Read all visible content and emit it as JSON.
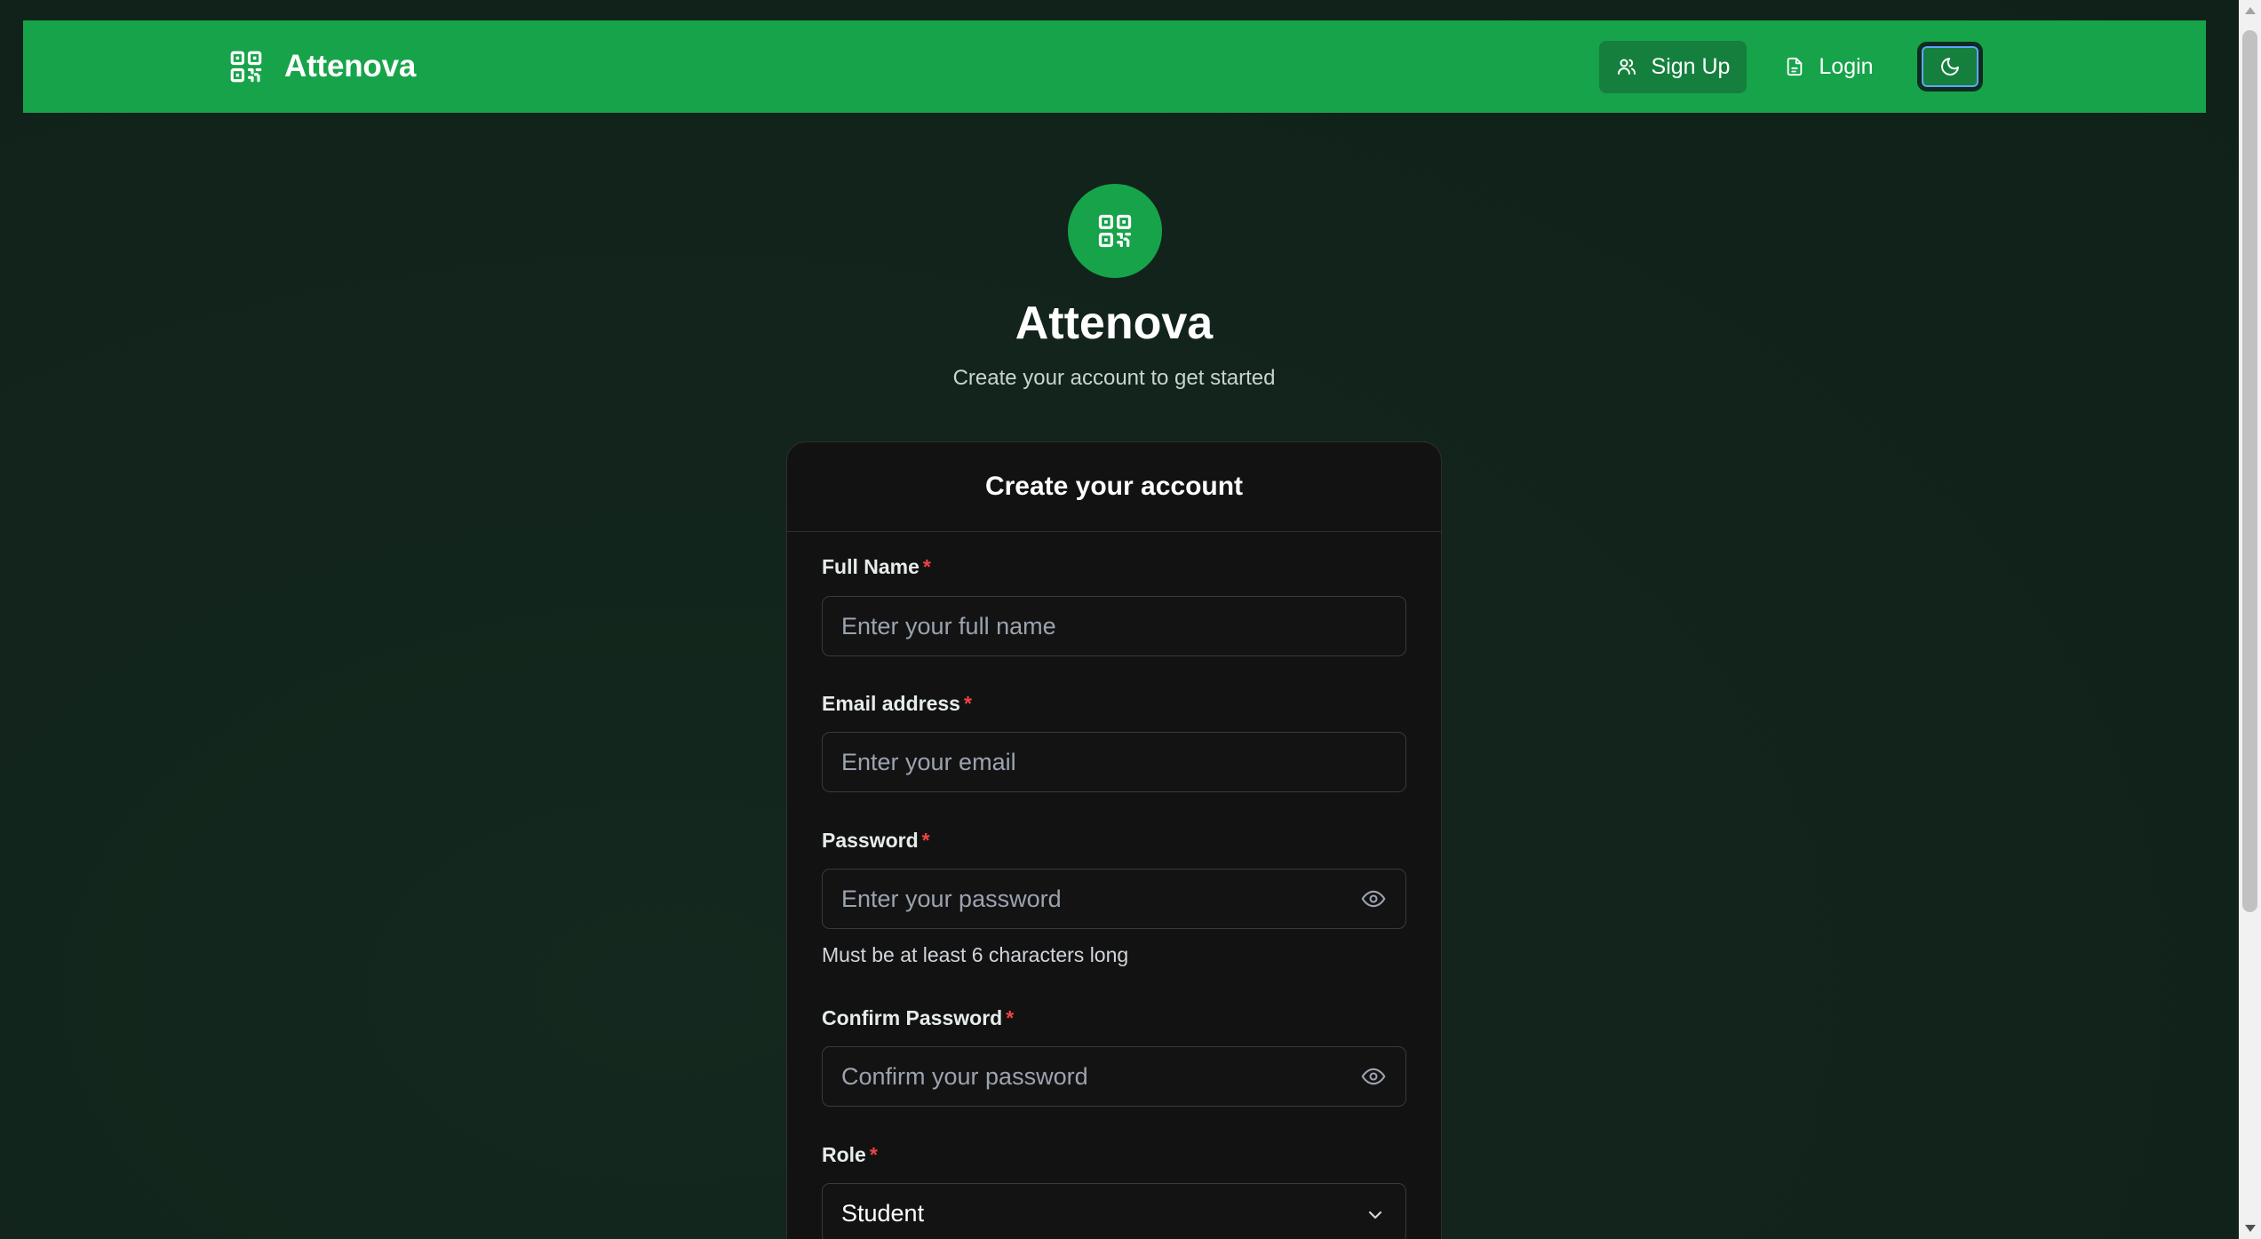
{
  "navbar": {
    "brand_name": "Attenova",
    "signup_label": "Sign Up",
    "login_label": "Login",
    "accent_color": "#17a34a"
  },
  "hero": {
    "title": "Attenova",
    "subtitle": "Create your account to get started"
  },
  "form": {
    "heading": "Create your account",
    "required_marker": "*",
    "full_name": {
      "label": "Full Name",
      "placeholder": "Enter your full name"
    },
    "email": {
      "label": "Email address",
      "placeholder": "Enter your email"
    },
    "password": {
      "label": "Password",
      "placeholder": "Enter your password",
      "hint": "Must be at least 6 characters long"
    },
    "confirm_password": {
      "label": "Confirm Password",
      "placeholder": "Confirm your password"
    },
    "role": {
      "label": "Role",
      "selected": "Student"
    }
  },
  "icons": {
    "brand": "qr-code-icon",
    "signup": "users-icon",
    "login": "file-icon",
    "theme": "moon-icon",
    "password_toggle": "eye-icon",
    "select": "chevron-down-icon"
  }
}
